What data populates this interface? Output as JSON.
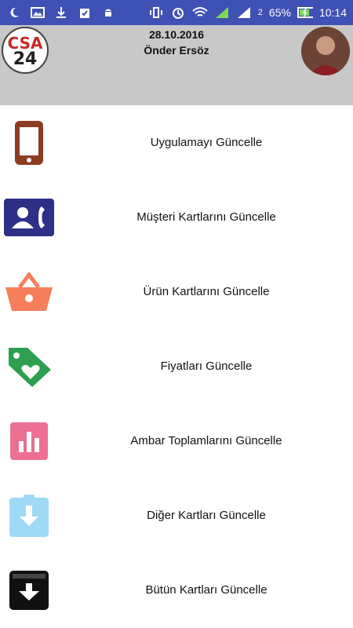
{
  "statusbar": {
    "network_label": "2",
    "battery": "65%",
    "time": "10:14"
  },
  "header": {
    "logo_top": "CSA",
    "logo_bottom": "24",
    "date": "28.10.2016",
    "user_name": "Önder Ersöz"
  },
  "menu": [
    {
      "label": "Uygulamayı Güncelle",
      "icon": "phone-icon"
    },
    {
      "label": "Müşteri Kartlarını Güncelle",
      "icon": "contact-card-icon"
    },
    {
      "label": "Ürün Kartlarını Güncelle",
      "icon": "basket-icon"
    },
    {
      "label": "Fiyatları Güncelle",
      "icon": "price-tag-icon"
    },
    {
      "label": "Ambar Toplamlarını Güncelle",
      "icon": "bar-chart-icon"
    },
    {
      "label": "Diğer Kartları Güncelle",
      "icon": "download-clipboard-icon"
    },
    {
      "label": "Bütün Kartları Güncelle",
      "icon": "archive-download-icon"
    }
  ],
  "colors": {
    "statusbar": "#3f51b5",
    "header": "#c8c8c8",
    "phone": "#8d3b21",
    "contact": "#2e2f86",
    "basket": "#f57f5b",
    "tag": "#2e9e4f",
    "chart": "#ec6f94",
    "clipboard": "#9fd9f6",
    "archive": "#111111"
  }
}
